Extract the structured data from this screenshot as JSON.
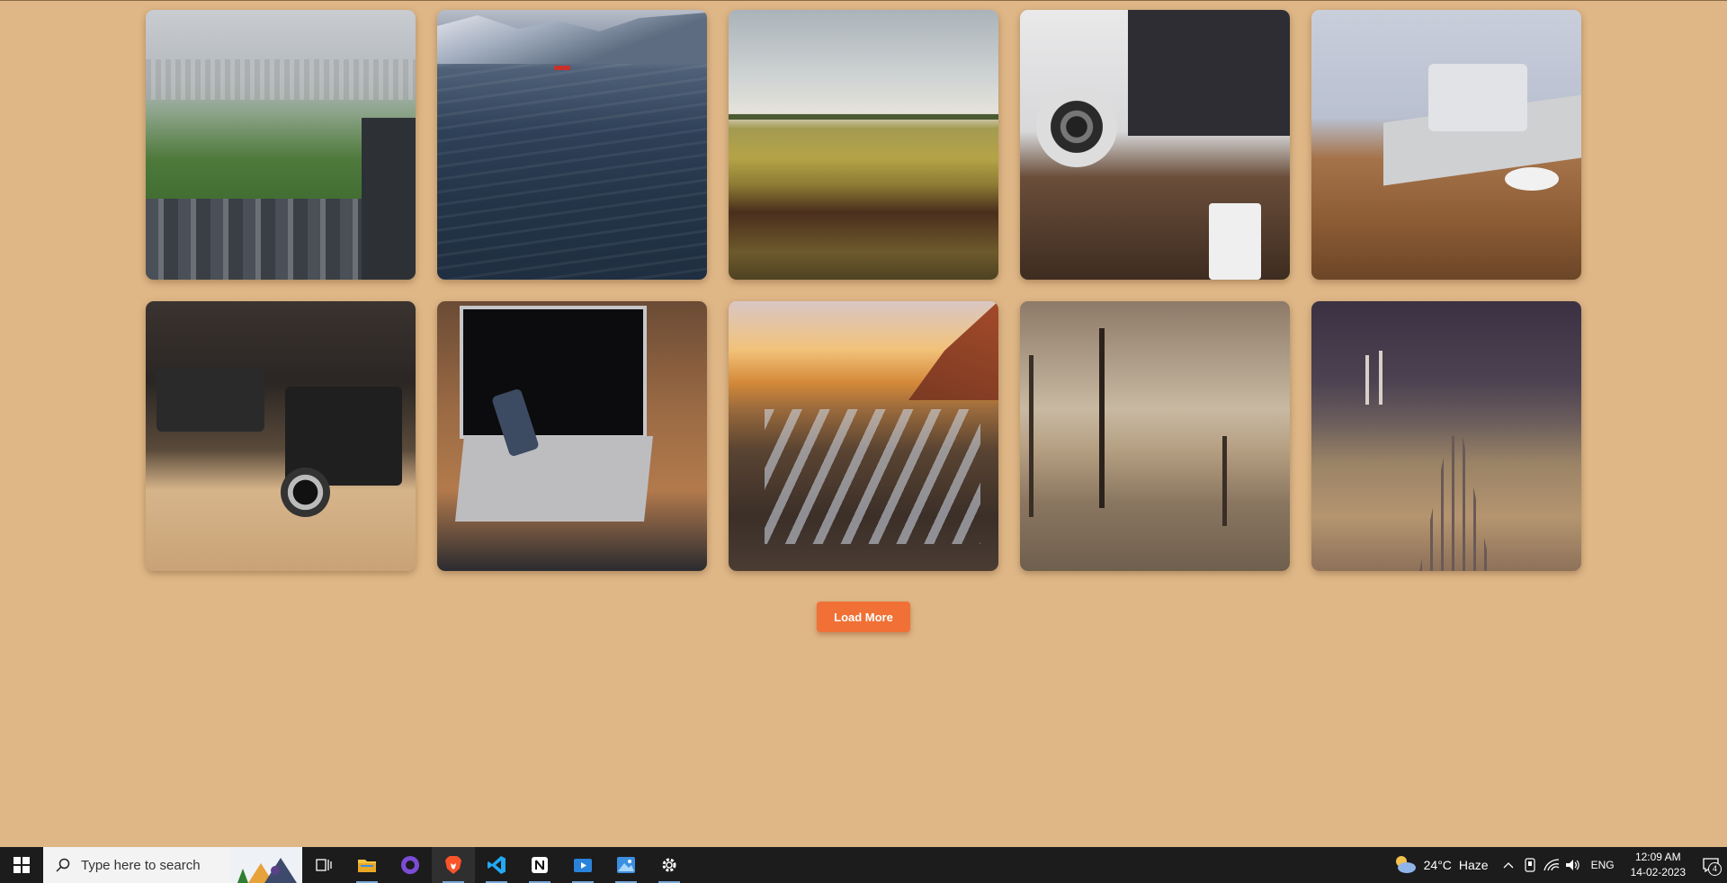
{
  "gallery": {
    "photos": [
      {
        "alt": "city-park-aerial"
      },
      {
        "alt": "ocean-mountains-boat"
      },
      {
        "alt": "wheat-field-clouds"
      },
      {
        "alt": "desk-speaker-imac"
      },
      {
        "alt": "glasses-on-laptop"
      },
      {
        "alt": "vintage-cameras"
      },
      {
        "alt": "laptop-phone-hand"
      },
      {
        "alt": "sunset-muddy-road"
      },
      {
        "alt": "dead-trees-fog"
      },
      {
        "alt": "railway-tracks-night"
      }
    ]
  },
  "load_more": {
    "label": "Load More"
  },
  "taskbar": {
    "search_placeholder": "Type here to search",
    "apps": [
      "task-view",
      "file-explorer",
      "github-desktop",
      "brave-browser",
      "vscode",
      "notion",
      "video-editor",
      "photos",
      "settings"
    ]
  },
  "tray": {
    "temperature": "24°C",
    "weather": "Haze",
    "language": "ENG",
    "time": "12:09 AM",
    "date": "14-02-2023",
    "notification_count": "4"
  },
  "colors": {
    "background": "#dfb787",
    "button": "#f07035",
    "taskbar": "#1c1c1c"
  }
}
